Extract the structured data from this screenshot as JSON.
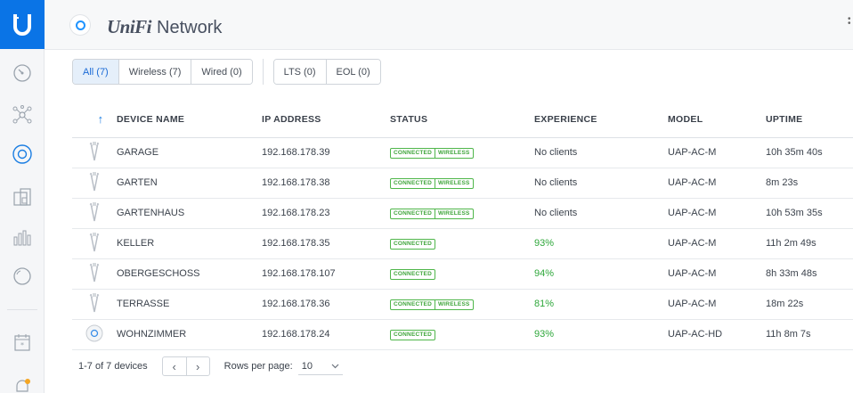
{
  "header": {
    "brand_unifi": "UniFi",
    "brand_network": "Network"
  },
  "filters": {
    "group1": [
      "All (7)",
      "Wireless (7)",
      "Wired (0)"
    ],
    "group2": [
      "LTS (0)",
      "EOL (0)"
    ],
    "active": "All (7)"
  },
  "table": {
    "columns": {
      "sort": "↑",
      "name": "DEVICE NAME",
      "ip": "IP ADDRESS",
      "status": "STATUS",
      "experience": "EXPERIENCE",
      "model": "MODEL",
      "uptime": "UPTIME"
    },
    "rows": [
      {
        "icon": "ap-ac-m-icon",
        "name": "GARAGE",
        "ip": "192.168.178.39",
        "status": "CONNECTED",
        "status_extra": "WIRELESS",
        "experience": "No clients",
        "model": "UAP-AC-M",
        "uptime": "10h 35m 40s"
      },
      {
        "icon": "ap-ac-m-icon",
        "name": "GARTEN",
        "ip": "192.168.178.38",
        "status": "CONNECTED",
        "status_extra": "WIRELESS",
        "experience": "No clients",
        "model": "UAP-AC-M",
        "uptime": "8m 23s"
      },
      {
        "icon": "ap-ac-m-icon",
        "name": "GARTENHAUS",
        "ip": "192.168.178.23",
        "status": "CONNECTED",
        "status_extra": "WIRELESS",
        "experience": "No clients",
        "model": "UAP-AC-M",
        "uptime": "10h 53m 35s"
      },
      {
        "icon": "ap-ac-m-icon",
        "name": "KELLER",
        "ip": "192.168.178.35",
        "status": "CONNECTED",
        "status_extra": "",
        "experience": "93%",
        "model": "UAP-AC-M",
        "uptime": "11h 2m 49s"
      },
      {
        "icon": "ap-ac-m-icon",
        "name": "OBERGESCHOSS",
        "ip": "192.168.178.107",
        "status": "CONNECTED",
        "status_extra": "",
        "experience": "94%",
        "model": "UAP-AC-M",
        "uptime": "8h 33m 48s"
      },
      {
        "icon": "ap-ac-m-icon",
        "name": "TERRASSE",
        "ip": "192.168.178.36",
        "status": "CONNECTED",
        "status_extra": "WIRELESS",
        "experience": "81%",
        "model": "UAP-AC-M",
        "uptime": "18m 22s"
      },
      {
        "icon": "ap-ac-hd-icon",
        "name": "WOHNZIMMER",
        "ip": "192.168.178.24",
        "status": "CONNECTED",
        "status_extra": "",
        "experience": "93%",
        "model": "UAP-AC-HD",
        "uptime": "11h 8m 7s"
      }
    ]
  },
  "footer": {
    "range": "1-7 of 7 devices",
    "prev": "‹",
    "next": "›",
    "rows_label": "Rows per page:",
    "rows_value": "10"
  },
  "colors": {
    "accent": "#0a74e6",
    "connected": "#4fb64a",
    "experience_good": "#2ea73a"
  }
}
